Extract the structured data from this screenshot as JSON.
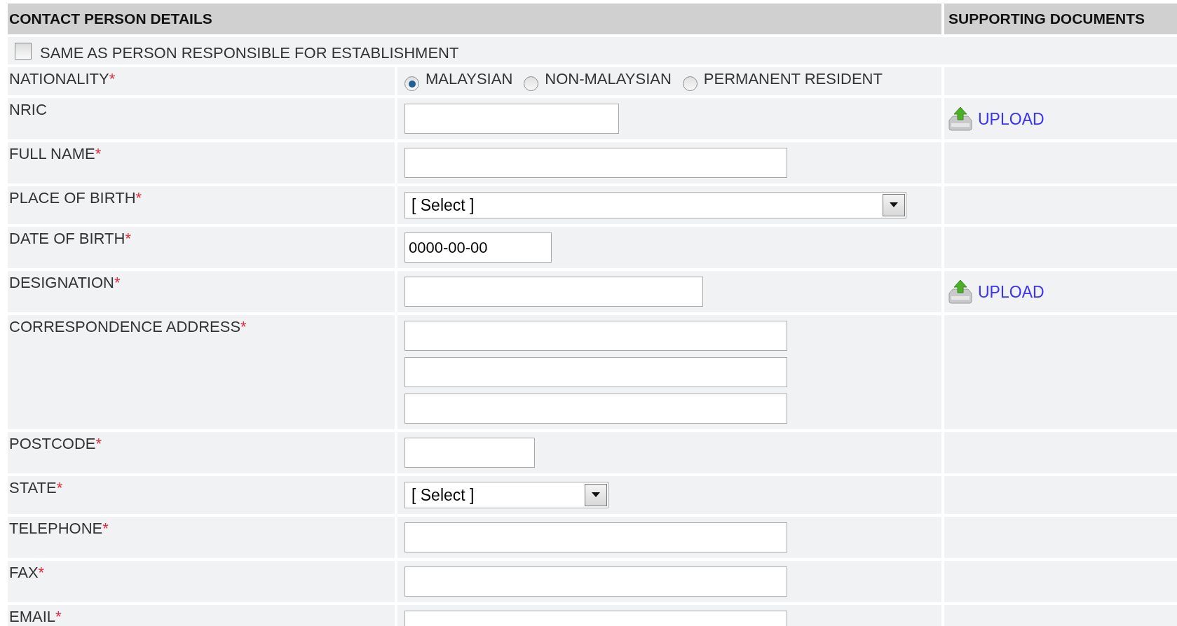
{
  "headers": [
    "CONTACT PERSON DETAILS",
    "SUPPORTING DOCUMENTS"
  ],
  "same_as": {
    "label": "SAME AS PERSON RESPONSIBLE FOR ESTABLISHMENT",
    "checked": false
  },
  "rows": [
    {
      "kind": "radio",
      "label": "NATIONALITY",
      "required_mark": "*",
      "options": [
        {
          "label": "MALAYSIAN",
          "selected": true
        },
        {
          "label": "NON-MALAYSIAN",
          "selected": false
        },
        {
          "label": "PERMANENT RESIDENT",
          "selected": false
        }
      ]
    },
    {
      "kind": "text",
      "label": "NRIC",
      "upload": "UPLOAD"
    },
    {
      "kind": "text",
      "label": "FULL NAME",
      "required_mark": "*"
    },
    {
      "kind": "select",
      "label": "PLACE OF BIRTH",
      "required_mark": "*",
      "value": "[ Select ]"
    },
    {
      "kind": "text",
      "label": "DATE OF BIRTH",
      "required_mark": "*",
      "value": "0000-00-00"
    },
    {
      "kind": "text",
      "label": "DESIGNATION",
      "required_mark": "*",
      "upload": "UPLOAD"
    },
    {
      "kind": "address",
      "label": "CORRESPONDENCE ADDRESS",
      "required_mark": "*"
    },
    {
      "kind": "text",
      "label": "POSTCODE",
      "required_mark": "*"
    },
    {
      "kind": "select",
      "label": "STATE",
      "required_mark": "*",
      "value": "[ Select ]"
    },
    {
      "kind": "text",
      "label": "TELEPHONE",
      "required_mark": "*"
    },
    {
      "kind": "text",
      "label": "FAX",
      "required_mark": "*"
    },
    {
      "kind": "text",
      "label": "EMAIL",
      "required_mark": "*"
    }
  ]
}
